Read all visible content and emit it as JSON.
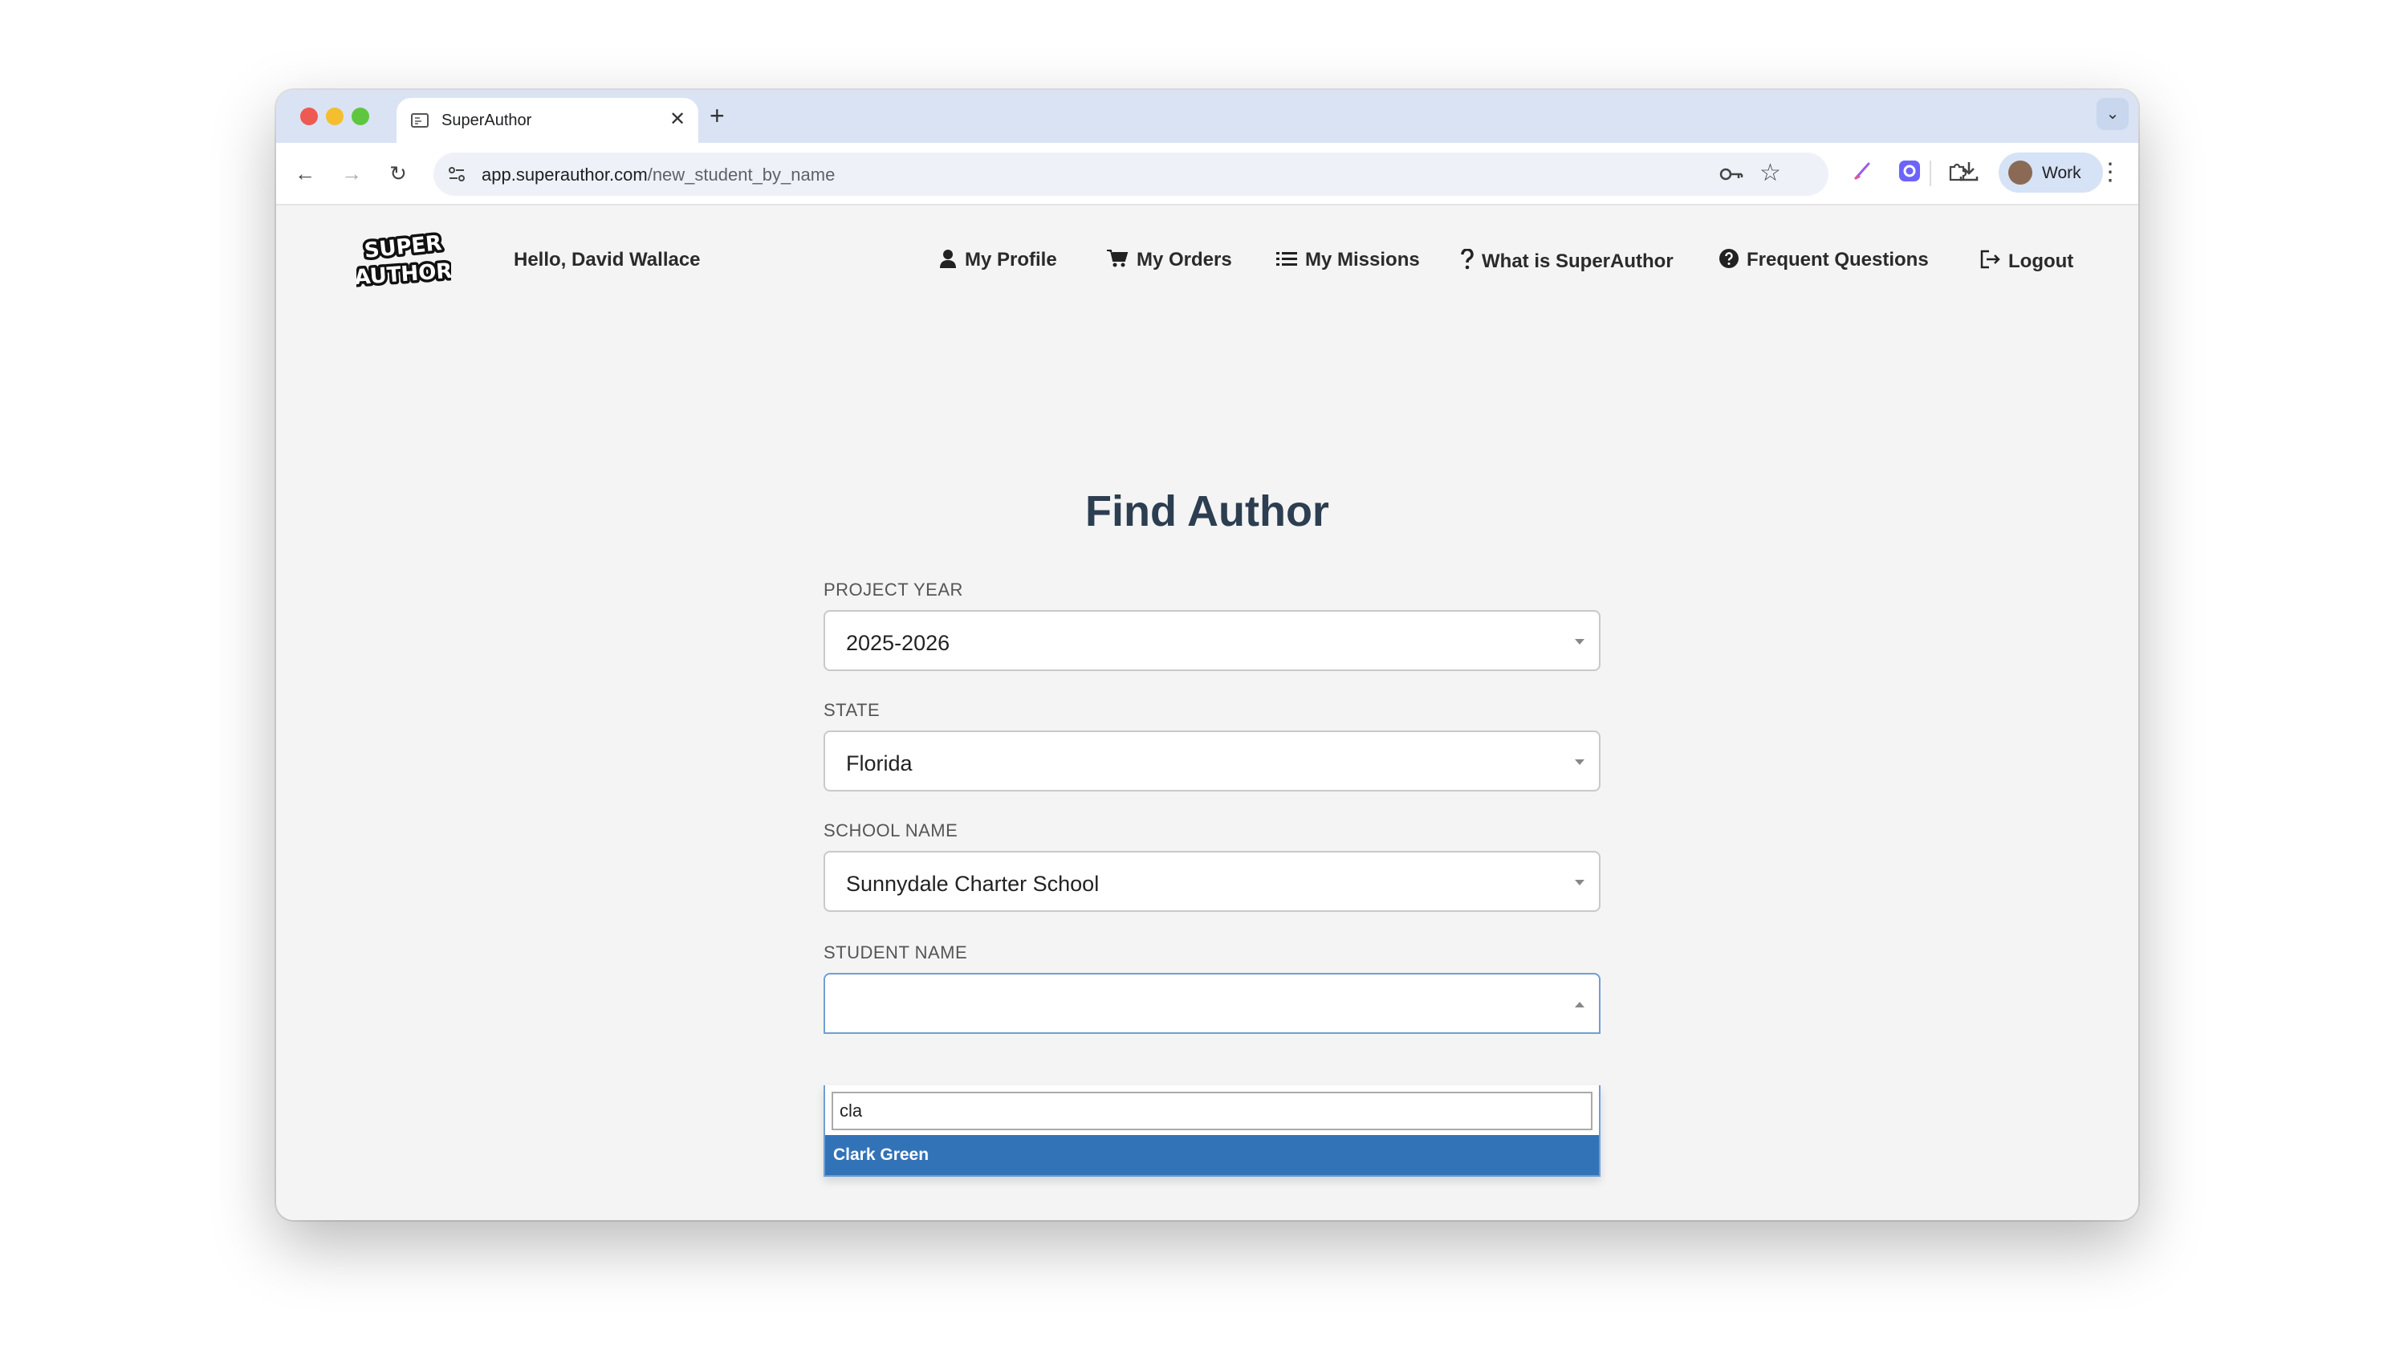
{
  "browser": {
    "tab_title": "SuperAuthor",
    "url_host": "app.superauthor.com",
    "url_path": "/new_student_by_name",
    "profile_label": "Work"
  },
  "header": {
    "logo_text": "SUPER AUTHOR",
    "greeting": "Hello, David Wallace",
    "nav": [
      {
        "label": "My Profile",
        "icon": "user-icon"
      },
      {
        "label": "My Orders",
        "icon": "cart-icon"
      },
      {
        "label": "My Missions",
        "icon": "list-icon"
      },
      {
        "label": "What is SuperAuthor",
        "icon": "question-icon"
      },
      {
        "label": "Frequent Questions",
        "icon": "question-circle-icon"
      },
      {
        "label": "Logout",
        "icon": "logout-icon"
      }
    ]
  },
  "form": {
    "title": "Find Author",
    "project_year": {
      "label": "PROJECT YEAR",
      "value": "2025-2026"
    },
    "state": {
      "label": "STATE",
      "value": "Florida"
    },
    "school_name": {
      "label": "SCHOOL NAME",
      "value": "Sunnydale Charter School"
    },
    "student_name": {
      "label": "STUDENT NAME",
      "value": "",
      "search_query": "cla",
      "options": [
        "Clark Green"
      ]
    }
  },
  "colors": {
    "accent": "#3273b8",
    "title": "#2c3e50",
    "tabstrip": "#d9e3f4"
  }
}
